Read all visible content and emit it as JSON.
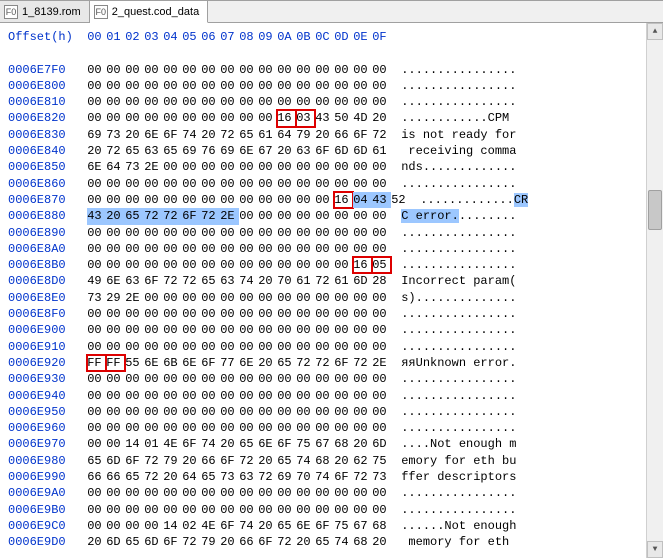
{
  "tabs": [
    {
      "label": "1_8139.rom",
      "active": false
    },
    {
      "label": "2_quest.cod_data",
      "active": true
    }
  ],
  "header_label": "Offset(h)",
  "columns": [
    "00",
    "01",
    "02",
    "03",
    "04",
    "05",
    "06",
    "07",
    "08",
    "09",
    "0A",
    "0B",
    "0C",
    "0D",
    "0E",
    "0F"
  ],
  "highlights": [
    {
      "row": 3,
      "from": 10,
      "to": 11,
      "type": "red"
    },
    {
      "row": 8,
      "from": 13,
      "to": 13,
      "type": "red"
    },
    {
      "row": 8,
      "from": 14,
      "to": 15,
      "type": "blue"
    },
    {
      "row": 9,
      "from": 0,
      "to": 7,
      "type": "blue"
    },
    {
      "row": 12,
      "from": 14,
      "to": 15,
      "type": "red"
    },
    {
      "row": 18,
      "from": 0,
      "to": 1,
      "type": "red"
    }
  ],
  "ascii_highlight": {
    "row": 8,
    "text_prefix": ".............",
    "hl": "CR"
  },
  "ascii_highlight2": {
    "row": 9,
    "hl": "C error.",
    "suffix": "........"
  },
  "rows": [
    {
      "offset": "0006E7F0",
      "bytes": [
        "00",
        "00",
        "00",
        "00",
        "00",
        "00",
        "00",
        "00",
        "00",
        "00",
        "00",
        "00",
        "00",
        "00",
        "00",
        "00"
      ],
      "ascii": "................"
    },
    {
      "offset": "0006E800",
      "bytes": [
        "00",
        "00",
        "00",
        "00",
        "00",
        "00",
        "00",
        "00",
        "00",
        "00",
        "00",
        "00",
        "00",
        "00",
        "00",
        "00"
      ],
      "ascii": "................"
    },
    {
      "offset": "0006E810",
      "bytes": [
        "00",
        "00",
        "00",
        "00",
        "00",
        "00",
        "00",
        "00",
        "00",
        "00",
        "00",
        "00",
        "00",
        "00",
        "00",
        "00"
      ],
      "ascii": "................"
    },
    {
      "offset": "0006E820",
      "bytes": [
        "00",
        "00",
        "00",
        "00",
        "00",
        "00",
        "00",
        "00",
        "00",
        "00",
        "16",
        "03",
        "43",
        "50",
        "4D",
        "20"
      ],
      "ascii": "............CPM "
    },
    {
      "offset": "0006E830",
      "bytes": [
        "69",
        "73",
        "20",
        "6E",
        "6F",
        "74",
        "20",
        "72",
        "65",
        "61",
        "64",
        "79",
        "20",
        "66",
        "6F",
        "72"
      ],
      "ascii": "is not ready for"
    },
    {
      "offset": "0006E840",
      "bytes": [
        "20",
        "72",
        "65",
        "63",
        "65",
        "69",
        "76",
        "69",
        "6E",
        "67",
        "20",
        "63",
        "6F",
        "6D",
        "6D",
        "61"
      ],
      "ascii": " receiving comma"
    },
    {
      "offset": "0006E850",
      "bytes": [
        "6E",
        "64",
        "73",
        "2E",
        "00",
        "00",
        "00",
        "00",
        "00",
        "00",
        "00",
        "00",
        "00",
        "00",
        "00",
        "00"
      ],
      "ascii": "nds............."
    },
    {
      "offset": "0006E860",
      "bytes": [
        "00",
        "00",
        "00",
        "00",
        "00",
        "00",
        "00",
        "00",
        "00",
        "00",
        "00",
        "00",
        "00",
        "00",
        "00",
        "00"
      ],
      "ascii": "................"
    },
    {
      "offset": "0006E870",
      "bytes": [
        "00",
        "00",
        "00",
        "00",
        "00",
        "00",
        "00",
        "00",
        "00",
        "00",
        "00",
        "00",
        "00",
        "16",
        "04",
        "43",
        "52"
      ],
      "ascii": ".............CR"
    },
    {
      "offset": "0006E880",
      "bytes": [
        "43",
        "20",
        "65",
        "72",
        "72",
        "6F",
        "72",
        "2E",
        "00",
        "00",
        "00",
        "00",
        "00",
        "00",
        "00",
        "00"
      ],
      "ascii": "C error........."
    },
    {
      "offset": "0006E890",
      "bytes": [
        "00",
        "00",
        "00",
        "00",
        "00",
        "00",
        "00",
        "00",
        "00",
        "00",
        "00",
        "00",
        "00",
        "00",
        "00",
        "00"
      ],
      "ascii": "................"
    },
    {
      "offset": "0006E8A0",
      "bytes": [
        "00",
        "00",
        "00",
        "00",
        "00",
        "00",
        "00",
        "00",
        "00",
        "00",
        "00",
        "00",
        "00",
        "00",
        "00",
        "00"
      ],
      "ascii": "................"
    },
    {
      "offset": "0006E8B0",
      "bytes": [
        "00",
        "00",
        "00",
        "00",
        "00",
        "00",
        "00",
        "00",
        "00",
        "00",
        "00",
        "00",
        "00",
        "00",
        "16",
        "05"
      ],
      "ascii": "................"
    },
    {
      "offset": "0006E8D0",
      "bytes": [
        "49",
        "6E",
        "63",
        "6F",
        "72",
        "72",
        "65",
        "63",
        "74",
        "20",
        "70",
        "61",
        "72",
        "61",
        "6D",
        "28"
      ],
      "ascii": "Incorrect param("
    },
    {
      "offset": "0006E8E0",
      "bytes": [
        "73",
        "29",
        "2E",
        "00",
        "00",
        "00",
        "00",
        "00",
        "00",
        "00",
        "00",
        "00",
        "00",
        "00",
        "00",
        "00"
      ],
      "ascii": "s).............."
    },
    {
      "offset": "0006E8F0",
      "bytes": [
        "00",
        "00",
        "00",
        "00",
        "00",
        "00",
        "00",
        "00",
        "00",
        "00",
        "00",
        "00",
        "00",
        "00",
        "00",
        "00"
      ],
      "ascii": "................"
    },
    {
      "offset": "0006E900",
      "bytes": [
        "00",
        "00",
        "00",
        "00",
        "00",
        "00",
        "00",
        "00",
        "00",
        "00",
        "00",
        "00",
        "00",
        "00",
        "00",
        "00"
      ],
      "ascii": "................"
    },
    {
      "offset": "0006E910",
      "bytes": [
        "00",
        "00",
        "00",
        "00",
        "00",
        "00",
        "00",
        "00",
        "00",
        "00",
        "00",
        "00",
        "00",
        "00",
        "00",
        "00"
      ],
      "ascii": "................"
    },
    {
      "offset": "0006E920",
      "bytes": [
        "FF",
        "FF",
        "55",
        "6E",
        "6B",
        "6E",
        "6F",
        "77",
        "6E",
        "20",
        "65",
        "72",
        "72",
        "6F",
        "72",
        "2E"
      ],
      "ascii": "яяUnknown error."
    },
    {
      "offset": "0006E930",
      "bytes": [
        "00",
        "00",
        "00",
        "00",
        "00",
        "00",
        "00",
        "00",
        "00",
        "00",
        "00",
        "00",
        "00",
        "00",
        "00",
        "00"
      ],
      "ascii": "................"
    },
    {
      "offset": "0006E940",
      "bytes": [
        "00",
        "00",
        "00",
        "00",
        "00",
        "00",
        "00",
        "00",
        "00",
        "00",
        "00",
        "00",
        "00",
        "00",
        "00",
        "00"
      ],
      "ascii": "................"
    },
    {
      "offset": "0006E950",
      "bytes": [
        "00",
        "00",
        "00",
        "00",
        "00",
        "00",
        "00",
        "00",
        "00",
        "00",
        "00",
        "00",
        "00",
        "00",
        "00",
        "00"
      ],
      "ascii": "................"
    },
    {
      "offset": "0006E960",
      "bytes": [
        "00",
        "00",
        "00",
        "00",
        "00",
        "00",
        "00",
        "00",
        "00",
        "00",
        "00",
        "00",
        "00",
        "00",
        "00",
        "00"
      ],
      "ascii": "................"
    },
    {
      "offset": "0006E970",
      "bytes": [
        "00",
        "00",
        "14",
        "01",
        "4E",
        "6F",
        "74",
        "20",
        "65",
        "6E",
        "6F",
        "75",
        "67",
        "68",
        "20",
        "6D"
      ],
      "ascii": "....Not enough m"
    },
    {
      "offset": "0006E980",
      "bytes": [
        "65",
        "6D",
        "6F",
        "72",
        "79",
        "20",
        "66",
        "6F",
        "72",
        "20",
        "65",
        "74",
        "68",
        "20",
        "62",
        "75"
      ],
      "ascii": "emory for eth bu"
    },
    {
      "offset": "0006E990",
      "bytes": [
        "66",
        "66",
        "65",
        "72",
        "20",
        "64",
        "65",
        "73",
        "63",
        "72",
        "69",
        "70",
        "74",
        "6F",
        "72",
        "73"
      ],
      "ascii": "ffer descriptors"
    },
    {
      "offset": "0006E9A0",
      "bytes": [
        "00",
        "00",
        "00",
        "00",
        "00",
        "00",
        "00",
        "00",
        "00",
        "00",
        "00",
        "00",
        "00",
        "00",
        "00",
        "00"
      ],
      "ascii": "................"
    },
    {
      "offset": "0006E9B0",
      "bytes": [
        "00",
        "00",
        "00",
        "00",
        "00",
        "00",
        "00",
        "00",
        "00",
        "00",
        "00",
        "00",
        "00",
        "00",
        "00",
        "00"
      ],
      "ascii": "................"
    },
    {
      "offset": "0006E9C0",
      "bytes": [
        "00",
        "00",
        "00",
        "00",
        "14",
        "02",
        "4E",
        "6F",
        "74",
        "20",
        "65",
        "6E",
        "6F",
        "75",
        "67",
        "68"
      ],
      "ascii": "......Not enough"
    },
    {
      "offset": "0006E9D0",
      "bytes": [
        "20",
        "6D",
        "65",
        "6D",
        "6F",
        "72",
        "79",
        "20",
        "66",
        "6F",
        "72",
        "20",
        "65",
        "74",
        "68",
        "20"
      ],
      "ascii": " memory for eth "
    }
  ]
}
